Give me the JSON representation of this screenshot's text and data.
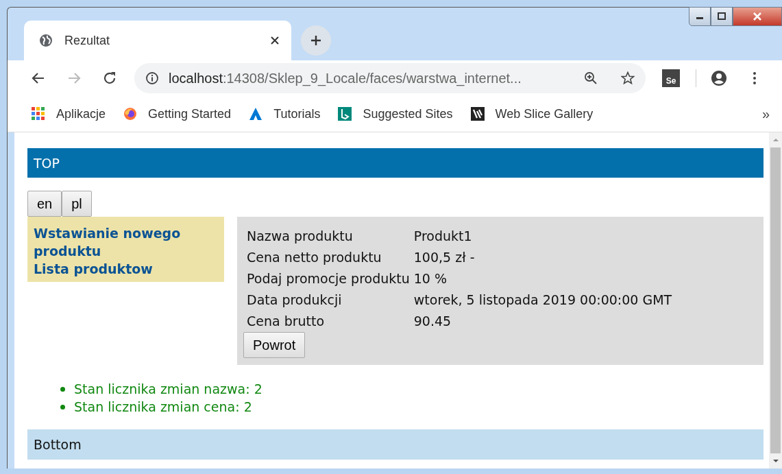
{
  "browser": {
    "tabs": [
      {
        "title": "Rezultat",
        "selected": true
      }
    ],
    "address": {
      "host": "localhost",
      "path": ":14308/Sklep_9_Locale/faces/warstwa_internet..."
    },
    "extension_label": "Se",
    "bookmarks": [
      {
        "kind": "apps",
        "label": "Aplikacje"
      },
      {
        "kind": "firefox",
        "label": "Getting Started"
      },
      {
        "kind": "triangle",
        "label": "Tutorials"
      },
      {
        "kind": "bing",
        "label": "Suggested Sites"
      },
      {
        "kind": "slice",
        "label": "Web Slice Gallery"
      }
    ],
    "bookmarks_overflow": "»"
  },
  "page": {
    "top": "TOP",
    "languages": [
      {
        "label": "en"
      },
      {
        "label": "pl"
      }
    ],
    "menu": [
      {
        "label": "Wstawianie nowego produktu"
      },
      {
        "label": "Lista produktow"
      }
    ],
    "details": [
      {
        "label": "Nazwa produktu",
        "value": "Produkt1"
      },
      {
        "label": "Cena netto produktu",
        "value": "100,5 zł -"
      },
      {
        "label": "Podaj promocje produktu",
        "value": "10 %"
      },
      {
        "label": "Data produkcji",
        "value": "wtorek, 5 listopada 2019 00:00:00 GMT"
      },
      {
        "label": "Cena brutto",
        "value": "90.45"
      }
    ],
    "back_button": "Powrot",
    "messages": [
      "Stan licznika zmian nazwa: 2",
      "Stan licznika zmian cena: 2"
    ],
    "bottom": "Bottom"
  }
}
